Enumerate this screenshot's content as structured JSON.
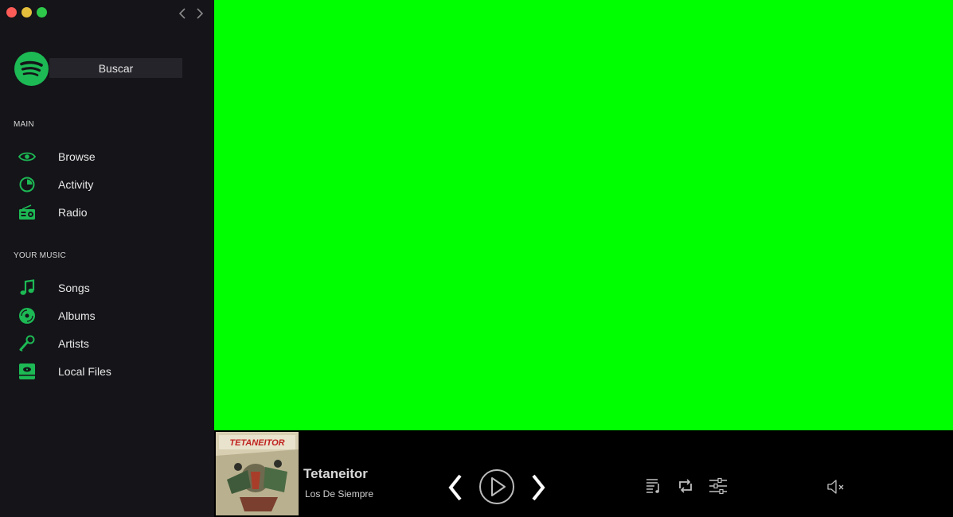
{
  "search": {
    "value": "Buscar"
  },
  "sidebar": {
    "main_title": "MAIN",
    "main_items": [
      {
        "label": "Browse",
        "icon": "eye-icon"
      },
      {
        "label": "Activity",
        "icon": "pie-chart-icon"
      },
      {
        "label": "Radio",
        "icon": "radio-icon"
      }
    ],
    "music_title": "YOUR MUSIC",
    "music_items": [
      {
        "label": "Songs",
        "icon": "music-note-icon"
      },
      {
        "label": "Albums",
        "icon": "disc-icon"
      },
      {
        "label": "Artists",
        "icon": "microphone-icon"
      },
      {
        "label": "Local Files",
        "icon": "hard-drive-icon"
      }
    ]
  },
  "player": {
    "track_title": "Tetaneitor",
    "artist": "Los De Siempre",
    "cover_title": "TETANEITOR"
  },
  "colors": {
    "accent": "#1db954",
    "sidebar_bg": "#141419",
    "content_bg": "#00ff00",
    "player_bg": "#000000"
  }
}
